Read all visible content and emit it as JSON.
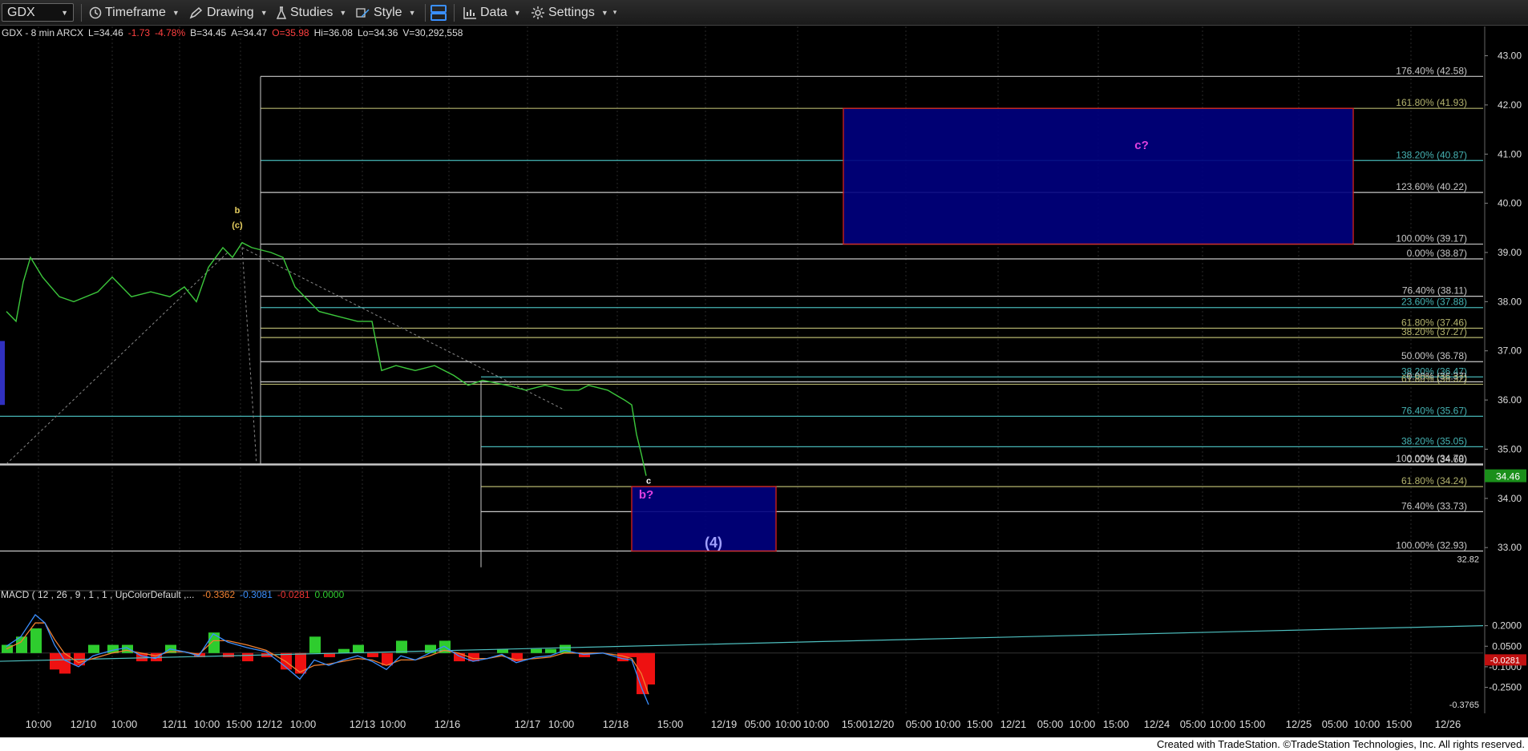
{
  "toolbar": {
    "symbol": "GDX",
    "timeframe": "Timeframe",
    "drawing": "Drawing",
    "studies": "Studies",
    "style": "Style",
    "data": "Data",
    "settings": "Settings"
  },
  "header": {
    "instrument": "GDX - 8 min  ARCX",
    "last": "L=34.46",
    "change": "-1.73",
    "change_pct": "-4.78%",
    "bid": "B=34.45",
    "ask": "A=34.47",
    "open": "O=35.98",
    "high": "Hi=36.08",
    "low": "Lo=34.36",
    "volume": "V=30,292,558"
  },
  "colors": {
    "price_line": "#3cc83c",
    "fib_white": "#c8c8c8",
    "fib_olive": "#b4b46e",
    "fib_teal": "#46b4b4",
    "box_fill": "#000080",
    "box_border": "#d02020",
    "magenta_label": "#e040e0",
    "macd_line": "#3a8fff",
    "signal_line": "#f08030",
    "hist_pos": "#2ecc2e",
    "hist_neg": "#ee1111",
    "trendline_macd": "#4ec0c0",
    "last_price_tag": "#1a8f1a"
  },
  "chart_data": [
    {
      "type": "line",
      "panel": "price",
      "title": "GDX - 8 min ARCX",
      "ylim": [
        32.4,
        43.4
      ],
      "y_ticks": [
        "43.00",
        "42.00",
        "41.00",
        "40.00",
        "39.00",
        "38.00",
        "37.00",
        "36.00",
        "35.00",
        "34.00",
        "33.00"
      ],
      "x_tick_labels": [
        "10:00",
        "12/10",
        "10:00",
        "12/11",
        "10:00",
        "15:00",
        "12/12",
        "10:00",
        "12/13",
        "10:00",
        "12/16",
        "12/17",
        "10:00",
        "12/18",
        "15:00",
        "12/19",
        "05:00",
        "10:00",
        "10:00",
        "15:00",
        "12/20",
        "05:00",
        "10:00",
        "15:00",
        "12/21",
        "05:00",
        "10:00",
        "15:00",
        "12/24",
        "05:00",
        "10:00",
        "15:00",
        "12/25",
        "05:00",
        "10:00",
        "15:00",
        "12/26"
      ],
      "series": [
        {
          "values": [
            [
              0,
              37.8
            ],
            [
              0.2,
              37.6
            ],
            [
              0.35,
              38.4
            ],
            [
              0.5,
              38.9
            ],
            [
              0.75,
              38.5
            ],
            [
              1.1,
              38.1
            ],
            [
              1.4,
              38.0
            ],
            [
              1.9,
              38.2
            ],
            [
              2.2,
              38.5
            ],
            [
              2.6,
              38.1
            ],
            [
              3.0,
              38.2
            ],
            [
              3.4,
              38.1
            ],
            [
              3.7,
              38.3
            ],
            [
              3.95,
              38.0
            ],
            [
              4.2,
              38.7
            ],
            [
              4.5,
              39.1
            ],
            [
              4.7,
              38.9
            ],
            [
              4.9,
              39.2
            ],
            [
              5.1,
              39.1
            ],
            [
              5.5,
              39.0
            ],
            [
              5.75,
              38.9
            ],
            [
              6.0,
              38.3
            ],
            [
              6.2,
              38.1
            ],
            [
              6.5,
              37.8
            ],
            [
              6.9,
              37.7
            ],
            [
              7.3,
              37.6
            ],
            [
              7.6,
              37.6
            ],
            [
              7.8,
              36.6
            ],
            [
              8.1,
              36.7
            ],
            [
              8.5,
              36.6
            ],
            [
              8.9,
              36.7
            ],
            [
              9.3,
              36.5
            ],
            [
              9.6,
              36.3
            ],
            [
              9.9,
              36.4
            ],
            [
              10.4,
              36.3
            ],
            [
              10.8,
              36.2
            ],
            [
              11.2,
              36.3
            ],
            [
              11.6,
              36.2
            ],
            [
              11.9,
              36.2
            ],
            [
              12.1,
              36.3
            ],
            [
              12.5,
              36.2
            ],
            [
              12.85,
              36.0
            ],
            [
              13.0,
              35.9
            ],
            [
              13.1,
              35.3
            ],
            [
              13.2,
              34.9
            ],
            [
              13.3,
              34.46
            ]
          ]
        }
      ],
      "fib_levels": [
        {
          "label": "176.40% (42.58)",
          "value": 42.58,
          "color": "white"
        },
        {
          "label": "161.80% (41.93)",
          "value": 41.93,
          "color": "olive"
        },
        {
          "label": "138.20% (40.87)",
          "value": 40.87,
          "color": "teal"
        },
        {
          "label": "123.60% (40.22)",
          "value": 40.22,
          "color": "white"
        },
        {
          "label": "100.00% (39.17)",
          "value": 39.17,
          "color": "white"
        },
        {
          "label": "0.00% (38.87)",
          "value": 38.87,
          "color": "white"
        },
        {
          "label": "76.40% (38.11)",
          "value": 38.11,
          "color": "white"
        },
        {
          "label": "23.60% (37.88)",
          "value": 37.88,
          "color": "teal"
        },
        {
          "label": "61.80% (37.46)",
          "value": 37.46,
          "color": "olive"
        },
        {
          "label": "38.20% (37.27)",
          "value": 37.27,
          "color": "olive"
        },
        {
          "label": "50.00% (36.78)",
          "value": 36.78,
          "color": "white"
        },
        {
          "label": "38.20% (36.47)",
          "value": 36.47,
          "color": "teal"
        },
        {
          "label": "0.00% (36.37)",
          "value": 36.37,
          "color": "white"
        },
        {
          "label": "61.80% (36.32)",
          "value": 36.32,
          "color": "olive"
        },
        {
          "label": "76.40% (35.67)",
          "value": 35.67,
          "color": "teal"
        },
        {
          "label": "38.20% (35.05)",
          "value": 35.05,
          "color": "teal"
        },
        {
          "label": "100.00% (34.70)",
          "value": 34.7,
          "color": "white"
        },
        {
          "label": "0.00% (34.68)",
          "value": 34.68,
          "color": "white"
        },
        {
          "label": "61.80% (34.24)",
          "value": 34.24,
          "color": "olive"
        },
        {
          "label": "76.40% (33.73)",
          "value": 33.73,
          "color": "white"
        },
        {
          "label": "100.00% (32.93)",
          "value": 32.93,
          "color": "white"
        }
      ],
      "boxes": [
        {
          "name": "c-target-box",
          "x0": 17.4,
          "x1": 28.0,
          "y_top": 41.93,
          "y_bottom": 39.17
        },
        {
          "name": "b-target-box",
          "x0": 13.0,
          "x1": 16.0,
          "y_top": 34.24,
          "y_bottom": 32.93
        }
      ],
      "annotations": [
        {
          "text": "b",
          "x": 4.8,
          "y": 39.8,
          "color": "#e8d060"
        },
        {
          "text": "(c)",
          "x": 4.8,
          "y": 39.5,
          "color": "#e8d060"
        },
        {
          "text": "c",
          "x": 13.35,
          "y": 34.3,
          "color": "#ffffff"
        },
        {
          "text": "b?",
          "x": 13.3,
          "y": 34.0,
          "color": "#e040e0"
        },
        {
          "text": "(4)",
          "x": 14.7,
          "y": 33.0,
          "color": "#a0a0ff"
        },
        {
          "text": "c?",
          "x": 23.6,
          "y": 41.1,
          "color": "#e040e0"
        }
      ],
      "last_price": "34.46",
      "extra_label": "32.82"
    },
    {
      "type": "line",
      "panel": "macd",
      "title": "MACD ( 12 , 26 , 9 , 1 , 1 , UpColorDefault ,...",
      "values_shown": [
        "-0.3362",
        "-0.3081",
        "-0.0281",
        "0.0000"
      ],
      "y_ticks": [
        "0.2000",
        "0.0500",
        "-0.1000",
        "-0.2500"
      ],
      "ylim": [
        -0.44,
        0.35
      ],
      "last_hist_tag": "-0.0281",
      "min_label": "-0.3765",
      "series": [
        {
          "name": "MACD",
          "values": [
            [
              0,
              0.05
            ],
            [
              0.3,
              0.12
            ],
            [
              0.6,
              0.28
            ],
            [
              0.8,
              0.22
            ],
            [
              1.0,
              0.06
            ],
            [
              1.2,
              -0.05
            ],
            [
              1.5,
              -0.1
            ],
            [
              1.8,
              -0.02
            ],
            [
              2.2,
              0.02
            ],
            [
              2.5,
              0.04
            ],
            [
              2.8,
              -0.02
            ],
            [
              3.1,
              -0.04
            ],
            [
              3.4,
              0.03
            ],
            [
              3.7,
              0.01
            ],
            [
              4.0,
              -0.02
            ],
            [
              4.3,
              0.14
            ],
            [
              4.6,
              0.08
            ],
            [
              5.0,
              0.04
            ],
            [
              5.4,
              0.01
            ],
            [
              5.8,
              -0.1
            ],
            [
              6.1,
              -0.19
            ],
            [
              6.4,
              -0.05
            ],
            [
              6.7,
              -0.09
            ],
            [
              7.0,
              -0.05
            ],
            [
              7.3,
              -0.02
            ],
            [
              7.6,
              -0.06
            ],
            [
              7.9,
              -0.12
            ],
            [
              8.2,
              -0.02
            ],
            [
              8.5,
              -0.05
            ],
            [
              8.8,
              0.0
            ],
            [
              9.1,
              0.05
            ],
            [
              9.4,
              -0.02
            ],
            [
              9.7,
              -0.06
            ],
            [
              10.0,
              -0.04
            ],
            [
              10.3,
              -0.01
            ],
            [
              10.6,
              -0.07
            ],
            [
              11.0,
              -0.03
            ],
            [
              11.3,
              -0.02
            ],
            [
              11.6,
              0.02
            ],
            [
              12.0,
              -0.01
            ],
            [
              12.4,
              0.0
            ],
            [
              12.8,
              -0.04
            ],
            [
              13.0,
              -0.05
            ],
            [
              13.2,
              -0.25
            ],
            [
              13.35,
              -0.3765
            ]
          ]
        },
        {
          "name": "Signal",
          "values": [
            [
              0,
              0.03
            ],
            [
              0.3,
              0.08
            ],
            [
              0.6,
              0.22
            ],
            [
              0.8,
              0.22
            ],
            [
              1.0,
              0.1
            ],
            [
              1.2,
              0.0
            ],
            [
              1.5,
              -0.07
            ],
            [
              1.8,
              -0.04
            ],
            [
              2.2,
              0.0
            ],
            [
              2.5,
              0.02
            ],
            [
              2.8,
              0.0
            ],
            [
              3.1,
              -0.02
            ],
            [
              3.4,
              0.01
            ],
            [
              3.7,
              0.01
            ],
            [
              4.0,
              -0.01
            ],
            [
              4.3,
              0.09
            ],
            [
              4.6,
              0.09
            ],
            [
              5.0,
              0.06
            ],
            [
              5.4,
              0.02
            ],
            [
              5.8,
              -0.06
            ],
            [
              6.1,
              -0.14
            ],
            [
              6.4,
              -0.09
            ],
            [
              6.7,
              -0.08
            ],
            [
              7.0,
              -0.06
            ],
            [
              7.3,
              -0.04
            ],
            [
              7.6,
              -0.05
            ],
            [
              7.9,
              -0.09
            ],
            [
              8.2,
              -0.05
            ],
            [
              8.5,
              -0.05
            ],
            [
              8.8,
              -0.02
            ],
            [
              9.1,
              0.02
            ],
            [
              9.4,
              0.0
            ],
            [
              9.7,
              -0.04
            ],
            [
              10.0,
              -0.04
            ],
            [
              10.3,
              -0.02
            ],
            [
              10.6,
              -0.05
            ],
            [
              11.0,
              -0.04
            ],
            [
              11.3,
              -0.03
            ],
            [
              11.6,
              0.0
            ],
            [
              12.0,
              0.0
            ],
            [
              12.4,
              0.0
            ],
            [
              12.8,
              -0.02
            ],
            [
              13.0,
              -0.04
            ],
            [
              13.2,
              -0.15
            ],
            [
              13.35,
              -0.3
            ]
          ]
        }
      ]
    }
  ],
  "footer": "Created with TradeStation. ©TradeStation Technologies, Inc. All rights reserved."
}
